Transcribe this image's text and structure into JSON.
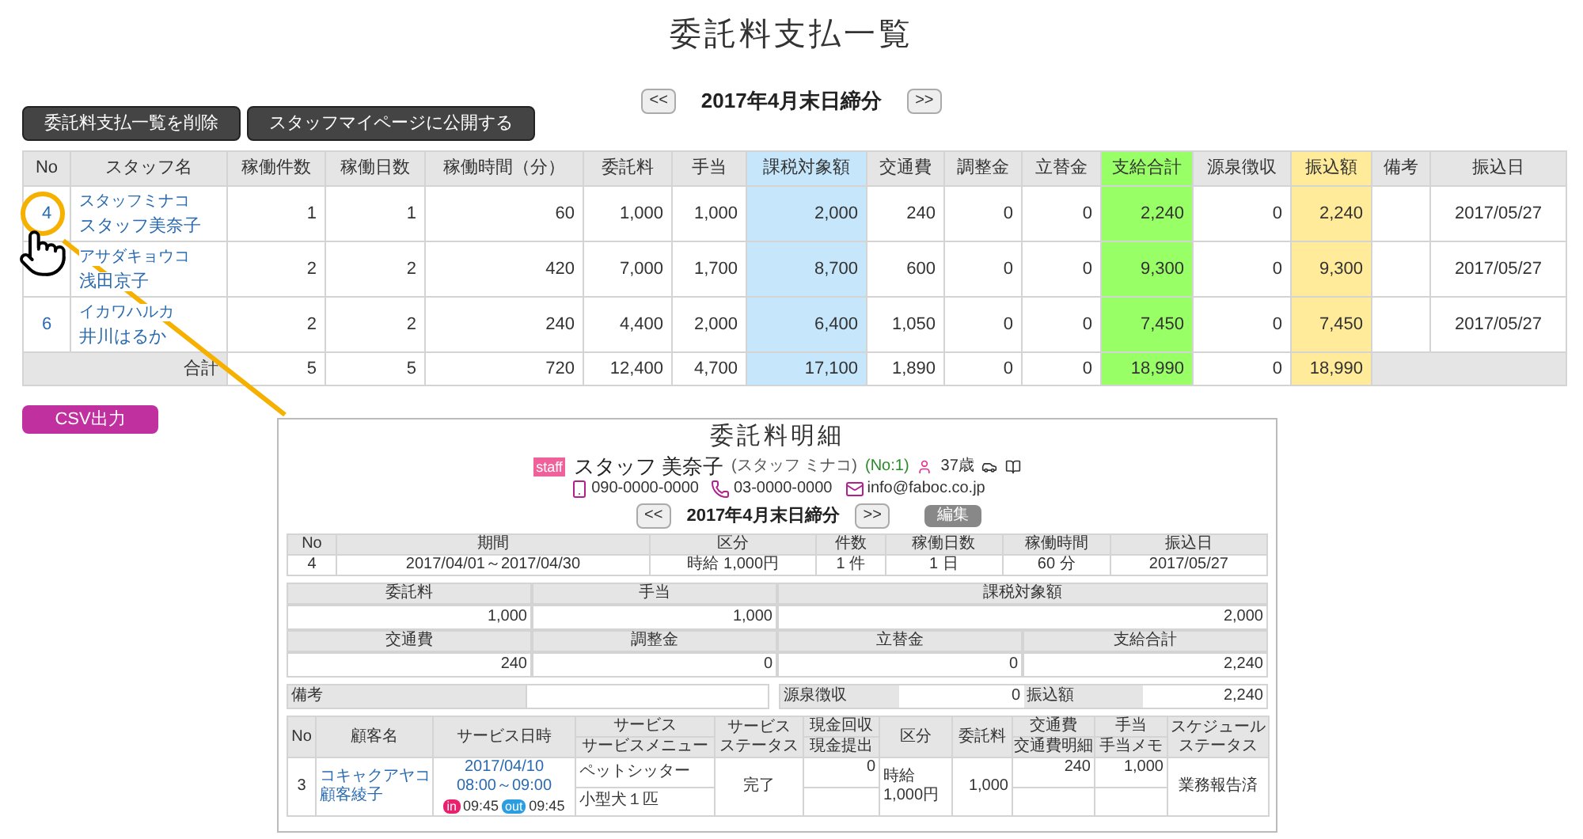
{
  "page_title": "委託料支払一覧",
  "actions": [
    {
      "label": "委託料支払一覧を削除"
    },
    {
      "label": "スタッフマイページに公開する"
    }
  ],
  "period_nav": {
    "prev": "<<",
    "label": "2017年4月末日締分",
    "next": ">>"
  },
  "table": {
    "columns": [
      {
        "label": "No"
      },
      {
        "label": "スタッフ名"
      },
      {
        "label": "稼働件数"
      },
      {
        "label": "稼働日数"
      },
      {
        "label": "稼働時間（分）"
      },
      {
        "label": "委託料"
      },
      {
        "label": "手当"
      },
      {
        "label": "課税対象額",
        "color": "#c5e6fb"
      },
      {
        "label": "交通費"
      },
      {
        "label": "調整金"
      },
      {
        "label": "立替金"
      },
      {
        "label": "支給合計",
        "color": "#99ff66"
      },
      {
        "label": "源泉徴収"
      },
      {
        "label": "振込額",
        "color": "#ffeb99"
      },
      {
        "label": "備考"
      },
      {
        "label": "振込日"
      }
    ],
    "rows": [
      {
        "highlighted": true,
        "cells": [
          "4",
          {
            "kana": "スタッフミナコ",
            "name": "スタッフ美奈子"
          },
          "1",
          "1",
          "60",
          "1,000",
          "1,000",
          "2,000",
          "240",
          "0",
          "0",
          "2,240",
          "0",
          "2,240",
          "",
          "2017/05/27"
        ]
      },
      {
        "highlighted": false,
        "cells": [
          "",
          {
            "kana": "アサダキョウコ",
            "name": "浅田京子"
          },
          "2",
          "2",
          "420",
          "7,000",
          "1,700",
          "8,700",
          "600",
          "0",
          "0",
          "9,300",
          "0",
          "9,300",
          "",
          "2017/05/27"
        ]
      },
      {
        "highlighted": false,
        "cells": [
          "6",
          {
            "kana": "イカワハルカ",
            "name": "井川はるか"
          },
          "2",
          "2",
          "240",
          "4,400",
          "2,000",
          "6,400",
          "1,050",
          "0",
          "0",
          "7,450",
          "0",
          "7,450",
          "",
          "2017/05/27"
        ]
      }
    ],
    "total": {
      "label": "合計",
      "cells": [
        "5",
        "5",
        "720",
        "12,400",
        "4,700",
        "17,100",
        "1,890",
        "0",
        "0",
        "18,990",
        "0",
        "18,990"
      ]
    }
  },
  "export_button": "CSV出力",
  "detail": {
    "title": "委託料明細",
    "staff": {
      "badge": "staff",
      "name": "スタッフ 美奈子",
      "kana": "(スタッフ ミナコ)",
      "number": "(No:1)",
      "age": "37歳"
    },
    "contacts": [
      {
        "kind": "mobile",
        "text": "090-0000-0000"
      },
      {
        "kind": "phone",
        "text": "03-0000-0000"
      },
      {
        "kind": "mail",
        "text": "info@faboc.co.jp"
      }
    ],
    "nav": {
      "prev": "<<",
      "label": "2017年4月末日締分",
      "next": ">>",
      "edit": "編集"
    },
    "summary": {
      "columns": [
        "No",
        "期間",
        "区分",
        "件数",
        "稼働日数",
        "稼働時間",
        "振込日"
      ],
      "row": [
        "4",
        "2017/04/01～2017/04/30",
        "時給 1,000円",
        "1 件",
        "1 日",
        "60 分",
        "2017/05/27"
      ]
    },
    "amounts": [
      [
        {
          "label": "委託料",
          "value": "1,000"
        },
        {
          "label": "手当",
          "value": "1,000"
        },
        {
          "label": "課税対象額",
          "value": "2,000"
        }
      ],
      [
        {
          "label": "交通費",
          "value": "240"
        },
        {
          "label": "調整金",
          "value": "0"
        },
        {
          "label": "立替金",
          "value": "0"
        },
        {
          "label": "支給合計",
          "value": "2,240"
        }
      ]
    ],
    "remarks": {
      "label": "備考"
    },
    "withholding": {
      "label": "源泉徴収",
      "value": "0"
    },
    "transfer": {
      "label": "振込額",
      "value": "2,240"
    },
    "services": {
      "columns": [
        {
          "kind": "single",
          "lines": [
            "No"
          ]
        },
        {
          "kind": "single",
          "lines": [
            "顧客名"
          ]
        },
        {
          "kind": "single",
          "lines": [
            "サービス日時"
          ]
        },
        {
          "kind": "split",
          "lines": [
            "サービス",
            "サービスメニュー"
          ]
        },
        {
          "kind": "stacked",
          "lines": [
            "サービス",
            "ステータス"
          ]
        },
        {
          "kind": "split",
          "lines": [
            "現金回収",
            "現金提出"
          ]
        },
        {
          "kind": "single",
          "lines": [
            "区分"
          ]
        },
        {
          "kind": "single",
          "lines": [
            "委託料"
          ]
        },
        {
          "kind": "split",
          "lines": [
            "交通費",
            "交通費明細"
          ]
        },
        {
          "kind": "split",
          "lines": [
            "手当",
            "手当メモ"
          ]
        },
        {
          "kind": "stacked",
          "lines": [
            "スケジュール",
            "ステータス"
          ]
        }
      ],
      "row": {
        "no": "3",
        "customer_kana": "コキャクアヤコ",
        "customer": "顧客綾子",
        "date": "2017/04/10",
        "time": "08:00～09:00",
        "checkin": {
          "badge": "in",
          "time": "09:45"
        },
        "checkout": {
          "badge": "out",
          "time": "09:45"
        },
        "service": "ペットシッター",
        "menu": "小型犬１匹",
        "status": "完了",
        "cash_collected": "0",
        "category": [
          "時給",
          "1,000円"
        ],
        "fee": "1,000",
        "transport": "240",
        "allowance": "1,000",
        "schedule_status": "業務報告済"
      }
    }
  }
}
